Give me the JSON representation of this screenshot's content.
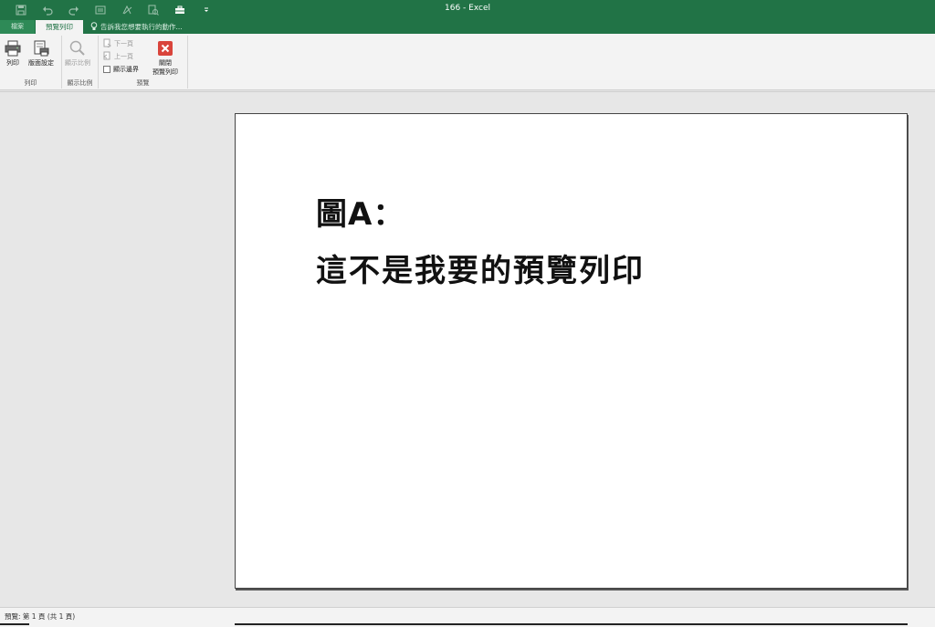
{
  "window": {
    "title": "166 - Excel"
  },
  "quick_access": [
    {
      "name": "save-icon",
      "enabled": false
    },
    {
      "name": "undo-icon",
      "enabled": false
    },
    {
      "name": "redo-icon",
      "enabled": false
    },
    {
      "name": "form-icon",
      "enabled": false
    },
    {
      "name": "sort-icon",
      "enabled": false
    },
    {
      "name": "zoom-icon",
      "enabled": false
    },
    {
      "name": "toolbox-icon",
      "enabled": true
    },
    {
      "name": "customize-qat-icon",
      "enabled": true
    }
  ],
  "tabs": {
    "file": "檔案",
    "preview": "預覽列印",
    "tell_me": "告訴我您想要執行的動作..."
  },
  "ribbon": {
    "print_group": {
      "label": "列印",
      "print_button": "列印",
      "page_setup_button": "版面設定"
    },
    "zoom_group": {
      "label": "顯示比例",
      "zoom_button": "顯示比例"
    },
    "preview_group": {
      "label": "預覽",
      "next_page": "下一頁",
      "previous_page": "上一頁",
      "show_margins": "顯示邊界",
      "close_line1": "關閉",
      "close_line2": "預覽列印"
    }
  },
  "page": {
    "line1": "圖A：",
    "line2": "這不是我要的預覽列印"
  },
  "status": {
    "text": "預覽: 第 1 頁 (共 1 頁)"
  },
  "colors": {
    "accent": "#217346",
    "close_red": "#d9443b"
  }
}
